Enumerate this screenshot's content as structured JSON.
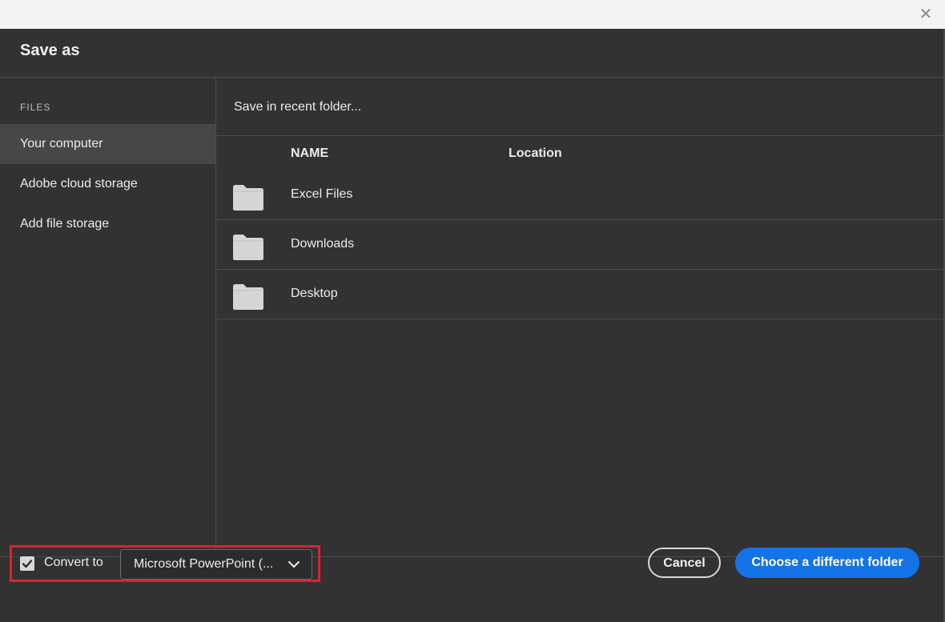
{
  "window": {
    "close_icon": "close-icon"
  },
  "dialog": {
    "title": "Save as"
  },
  "sidebar": {
    "heading": "FILES",
    "items": [
      {
        "label": "Your computer",
        "selected": true
      },
      {
        "label": "Adobe cloud storage",
        "selected": false
      },
      {
        "label": "Add file storage",
        "selected": false
      }
    ]
  },
  "main": {
    "recent_label": "Save in recent folder...",
    "columns": {
      "name": "NAME",
      "location": "Location"
    },
    "folders": [
      {
        "name": "Excel Files",
        "icon": "folder-icon"
      },
      {
        "name": "Downloads",
        "icon": "folder-icon"
      },
      {
        "name": "Desktop",
        "icon": "folder-icon"
      }
    ]
  },
  "footer": {
    "convert_checked": true,
    "convert_label": "Convert to",
    "format_value": "Microsoft PowerPoint (...",
    "cancel_label": "Cancel",
    "primary_label": "Choose a different folder"
  },
  "colors": {
    "background": "#323232",
    "selected_item": "#474747",
    "primary_button": "#1473e6",
    "highlight_box": "#e0202e"
  }
}
